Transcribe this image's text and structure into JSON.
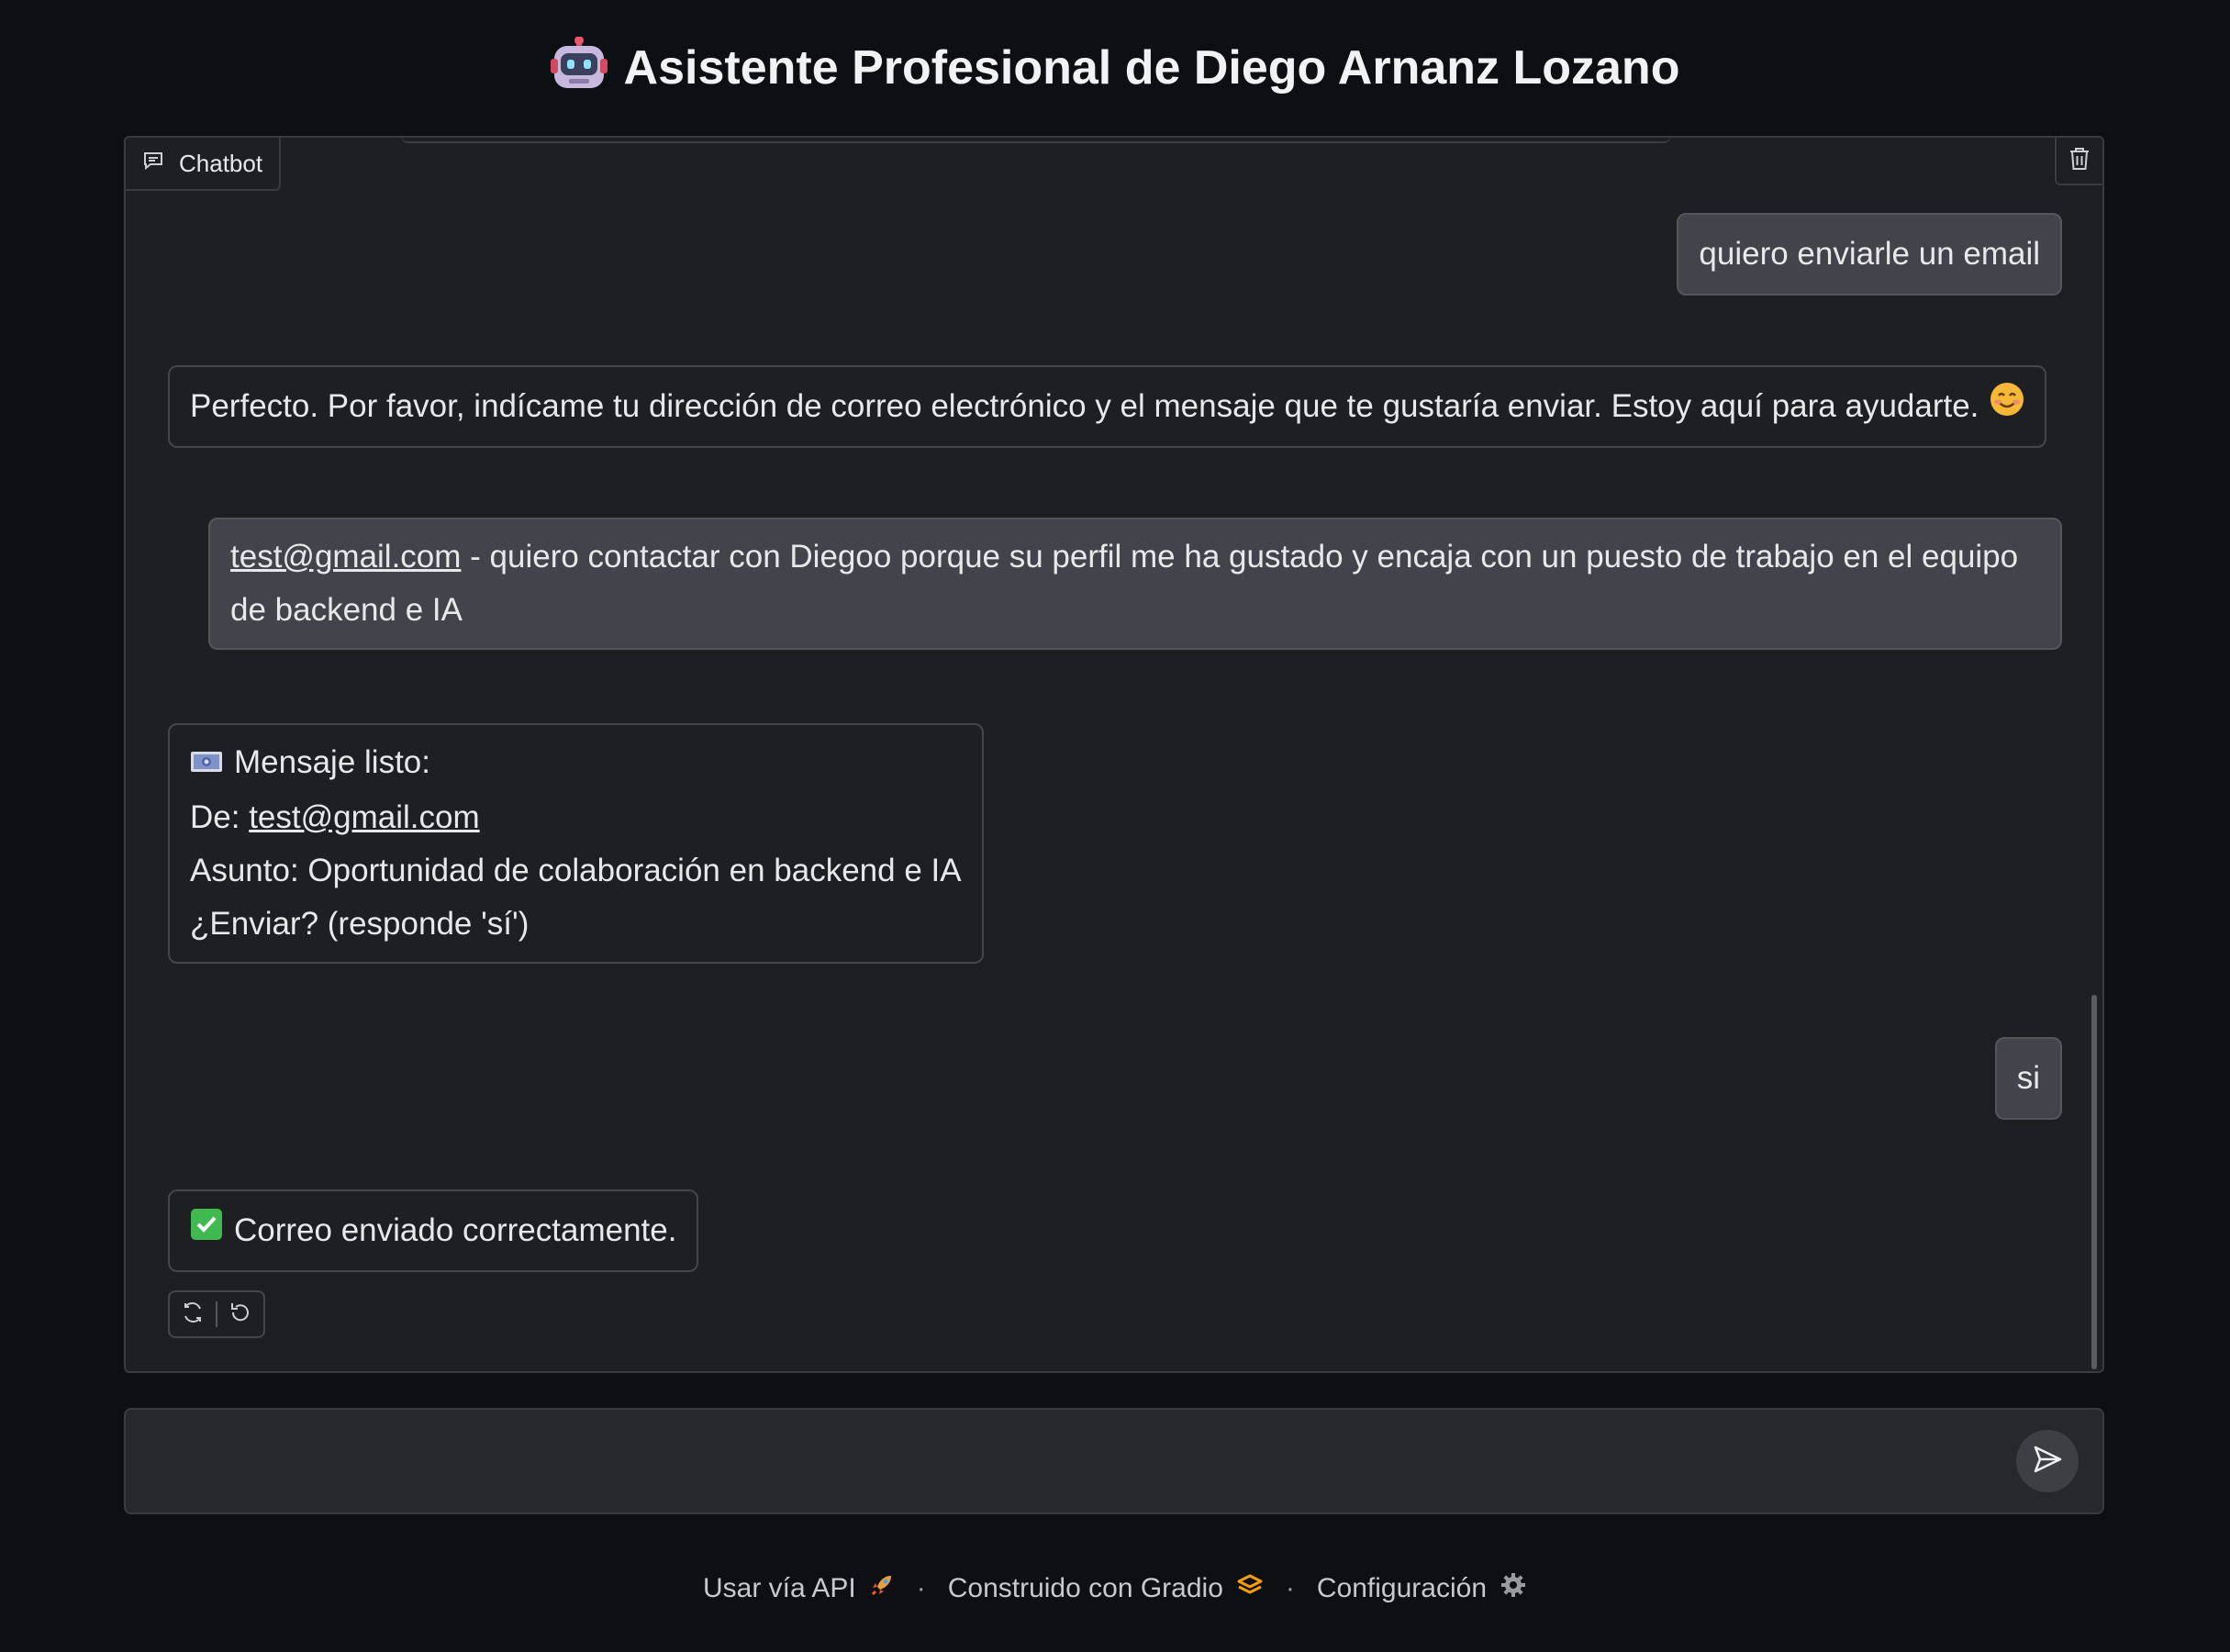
{
  "header": {
    "title": "Asistente Profesional de Diego Arnanz Lozano",
    "icon": "robot-icon"
  },
  "chatbot": {
    "label": "Chatbot",
    "messages": [
      {
        "role": "user",
        "text": "quiero enviarle un email"
      },
      {
        "role": "assistant",
        "text": "Perfecto. Por favor, indícame tu dirección de correo electrónico y el mensaje que te gustaría enviar. Estoy aquí para ayudarte.",
        "emoji": "smiling-face-icon"
      },
      {
        "role": "user",
        "link": "test@gmail.com",
        "text": " - quiero contactar con Diegoo porque su perfil me ha gustado y encaja con un puesto de trabajo en el equipo de backend e IA"
      },
      {
        "role": "assistant",
        "line1": "Mensaje listo:",
        "from_label": "De: ",
        "from_link": "test@gmail.com",
        "subject": "Asunto: Oportunidad de colaboración en backend e IA",
        "confirm": "¿Enviar? (responde 'sí')"
      },
      {
        "role": "user",
        "text": "si"
      },
      {
        "role": "assistant",
        "text": "Correo enviado correctamente.",
        "emoji": "check-mark-icon"
      }
    ]
  },
  "input": {
    "placeholder": "",
    "value": ""
  },
  "footer": {
    "api": "Usar vía API",
    "built": "Construido con Gradio",
    "settings": "Configuración"
  },
  "colors": {
    "background": "#0e0f12",
    "panel": "#1e1f23",
    "user_bubble": "#43444b",
    "check_green": "#3fb950"
  }
}
